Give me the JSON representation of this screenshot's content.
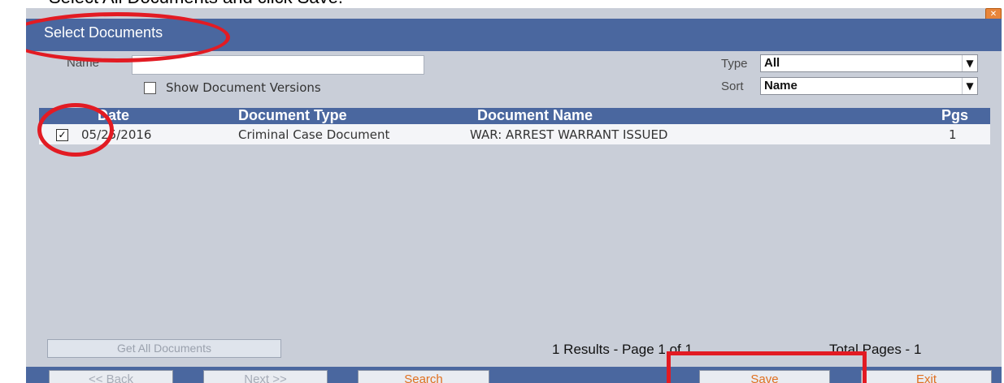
{
  "page_caption": "Select All Documents and click Save.",
  "dialog": {
    "title": "Select Documents",
    "close_icon": "close-icon"
  },
  "filters": {
    "name_label": "Name",
    "name_value": "",
    "show_versions_label": "Show Document Versions",
    "show_versions_checked": false,
    "type_label": "Type",
    "type_value": "All",
    "sort_label": "Sort",
    "sort_value": "Name"
  },
  "grid": {
    "columns": [
      "Date",
      "Document Type",
      "Document Name",
      "Pgs"
    ],
    "rows": [
      {
        "checked": true,
        "date": "05/25/2016",
        "document_type": "Criminal Case Document",
        "document_name": "WAR: ARREST WARRANT ISSUED",
        "pgs": "1"
      }
    ]
  },
  "footer": {
    "get_all_label": "Get All Documents",
    "results_text": "1 Results - Page 1 of 1",
    "total_pages_text": "Total Pages - 1"
  },
  "actions": {
    "back_label": "<< Back",
    "next_label": "Next >>",
    "search_label": "Search",
    "save_label": "Save",
    "exit_label": "Exit"
  },
  "colors": {
    "title_bar": "#4a679f",
    "dialog_bg": "#c9ced8",
    "annotation": "#e21b23",
    "active_button_text": "#e07020"
  }
}
